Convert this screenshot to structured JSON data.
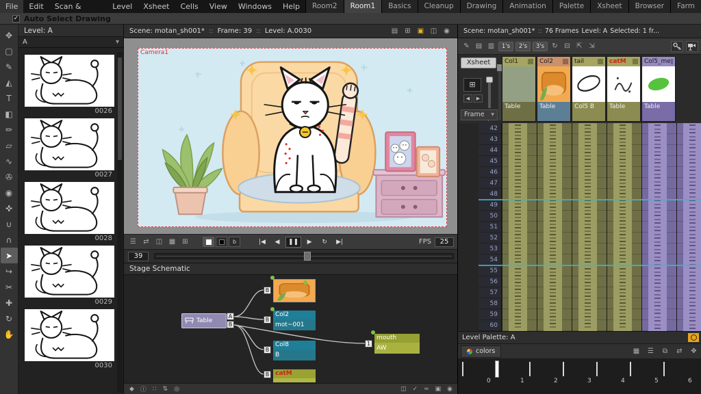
{
  "colors": {
    "olive_header": "#a6a562",
    "olive_cell": "#6e6f45",
    "olive_stripe": "#9c9d63",
    "salmon_header": "#cb916c",
    "purple_header": "#998ac0",
    "purple_cell": "#756aa0",
    "teal_node": "#1f7f98",
    "olive_node": "#96a033",
    "table_node": "#9189b2",
    "marker_cyan": "#3fb6c9",
    "camera_red": "#e03030",
    "catm_red": "#cc2415",
    "power_yellow": "#e6a520"
  },
  "menubar": {
    "items": [
      "File",
      "Edit",
      "Scan & Cleanup",
      "Level",
      "Xsheet",
      "Cells",
      "View",
      "Windows",
      "Help"
    ]
  },
  "rooms": {
    "tabs": [
      "Room2",
      "Room1",
      "Basics",
      "Cleanup",
      "Drawing",
      "Animation",
      "Palette",
      "Xsheet",
      "Browser",
      "Farm"
    ],
    "active": "Room1"
  },
  "options_bar": {
    "auto_select_label": "Auto Select Drawing"
  },
  "tools": {
    "items": [
      {
        "name": "animate-tool",
        "glyph": "✥"
      },
      {
        "name": "selection-tool",
        "glyph": "▢"
      },
      {
        "name": "brush-tool",
        "glyph": "✎"
      },
      {
        "name": "geometric-tool",
        "glyph": "◭"
      },
      {
        "name": "type-tool",
        "glyph": "T"
      },
      {
        "name": "fill-tool",
        "glyph": "◧"
      },
      {
        "name": "paint-brush-tool",
        "glyph": "✏"
      },
      {
        "name": "eraser-tool",
        "glyph": "▱"
      },
      {
        "name": "tape-tool",
        "glyph": "∿"
      },
      {
        "name": "style-picker-tool",
        "glyph": "✇"
      },
      {
        "name": "rgb-picker-tool",
        "glyph": "◉"
      },
      {
        "name": "control-point-tool",
        "glyph": "✜"
      },
      {
        "name": "pinch-tool",
        "glyph": "∪"
      },
      {
        "name": "pump-tool",
        "glyph": "∩"
      },
      {
        "name": "pointer-tool",
        "glyph": "➤"
      },
      {
        "name": "bender-tool",
        "glyph": "↪"
      },
      {
        "name": "cutter-tool",
        "glyph": "✂"
      },
      {
        "name": "hook-tool",
        "glyph": "✚"
      },
      {
        "name": "rotate-tool",
        "glyph": "↻"
      },
      {
        "name": "hand-tool",
        "glyph": "✋"
      }
    ]
  },
  "level_strip": {
    "title": "Level:  A",
    "selector_value": "A",
    "drawings": [
      "0026",
      "0027",
      "0028",
      "0029",
      "0030"
    ]
  },
  "viewer": {
    "scene": "Scene: motan_sh001*",
    "sep": "::",
    "frame": "Frame: 39",
    "level": "Level: A.0030",
    "camera_name": "Camera1",
    "fps_label": "FPS",
    "fps_value": "25",
    "frame_value": "39",
    "view_mode_b": "b",
    "header_icons": [
      {
        "name": "safe-area-icon",
        "glyph": "▤"
      },
      {
        "name": "field-guide-icon",
        "glyph": "⊞"
      },
      {
        "name": "camera-view-icon",
        "glyph": "▣"
      },
      {
        "name": "freeze-icon",
        "glyph": "◫"
      },
      {
        "name": "preview-icon",
        "glyph": "◉"
      }
    ]
  },
  "playback": {
    "left_icons": [
      {
        "name": "console-icon",
        "glyph": "☰"
      },
      {
        "name": "flip-horizontal-icon",
        "glyph": "⇄"
      },
      {
        "name": "compare-icon",
        "glyph": "◫"
      },
      {
        "name": "histogram-icon",
        "glyph": "▦"
      },
      {
        "name": "locator-icon",
        "glyph": "⊞"
      }
    ],
    "transport": [
      {
        "name": "first-frame-button",
        "glyph": "|◀"
      },
      {
        "name": "prev-frame-button",
        "glyph": "◀"
      },
      {
        "name": "pause-button",
        "glyph": "❚❚"
      },
      {
        "name": "play-button",
        "glyph": "▶"
      },
      {
        "name": "loop-button",
        "glyph": "↻"
      },
      {
        "name": "last-frame-button",
        "glyph": "▶|"
      }
    ]
  },
  "schematic": {
    "title": "Stage Schematic",
    "table_label": "Table",
    "port_a": "A",
    "port_b": "B",
    "port_1": "1",
    "nodes": {
      "col2": {
        "label": "Col2",
        "body": "mot~001"
      },
      "col8": {
        "label": "Col8",
        "body": "B"
      },
      "catm": {
        "label": "catM"
      },
      "mouth": {
        "label": "mouth",
        "body": "AW"
      }
    }
  },
  "bottom_toolbar": {
    "left": [
      {
        "name": "set-key-icon",
        "glyph": "◆"
      },
      {
        "name": "info-icon",
        "glyph": "ⓘ"
      },
      {
        "name": "grid-dots-icon",
        "glyph": "∷"
      },
      {
        "name": "swap-icon",
        "glyph": "⇅"
      },
      {
        "name": "target-icon",
        "glyph": "◎"
      }
    ],
    "right": [
      {
        "name": "toggle-panel-icon",
        "glyph": "◫"
      },
      {
        "name": "check-icon",
        "glyph": "✓"
      },
      {
        "name": "onion-skin-icon",
        "glyph": "≈"
      },
      {
        "name": "snap-icon",
        "glyph": "▣"
      },
      {
        "name": "camera-toggle-icon",
        "glyph": "◉"
      }
    ]
  },
  "xsheet": {
    "scene": "Scene: motan_sh001*",
    "sep": "::",
    "frames": "76 Frames",
    "level": "Level: A",
    "selected": "Selected: 1 fr...",
    "toolbar": {
      "icons_left": [
        {
          "name": "new-vector-level-icon",
          "glyph": "✎"
        },
        {
          "name": "new-toonz-raster-level-icon",
          "glyph": "▤"
        },
        {
          "name": "new-raster-level-icon",
          "glyph": "▥"
        }
      ],
      "steps": [
        "1's",
        "2's",
        "3's"
      ],
      "icons_mid": [
        {
          "name": "repeat-icon",
          "glyph": "↻"
        },
        {
          "name": "collapse-icon",
          "glyph": "⊟"
        },
        {
          "name": "open-subxsheet-icon",
          "glyph": "⇱"
        },
        {
          "name": "close-subxsheet-icon",
          "glyph": "⇲"
        }
      ]
    },
    "xsheet_button": "Xsheet",
    "frame_selector": "Frame",
    "columns": [
      {
        "name": "Col1",
        "parent": "Table",
        "header_hex": "#a6a562",
        "cell_hex": "#6e6f45"
      },
      {
        "name": "Col2",
        "parent": "Table",
        "header_hex": "#cb916c",
        "cell_hex": "#6e6f45"
      },
      {
        "name": "tail",
        "parent": "Col5  B",
        "header_hex": "#a6a562",
        "cell_hex": "#6e6f45"
      },
      {
        "name": "catM",
        "parent": "Table",
        "header_hex": "#a6a562",
        "cell_hex": "#6e6f45",
        "name_hex": "#cc2415"
      },
      {
        "name": "Col5_me",
        "parent": "Table",
        "header_hex": "#998ac0",
        "cell_hex": "#756aa0"
      }
    ],
    "rows": [
      "42",
      "43",
      "44",
      "45",
      "46",
      "47",
      "48",
      "49",
      "50",
      "51",
      "52",
      "53",
      "54",
      "55",
      "56",
      "57",
      "58",
      "59",
      "60"
    ]
  },
  "palette": {
    "title": "Level Palette: A",
    "tab": "colors",
    "toolbar_icons": [
      {
        "name": "grid-view-icon",
        "glyph": "▦"
      },
      {
        "name": "list-view-icon",
        "glyph": "☰"
      },
      {
        "name": "copy-page-icon",
        "glyph": "⧉"
      },
      {
        "name": "swap-colors-icon",
        "glyph": "⇄"
      },
      {
        "name": "palette-options-icon",
        "glyph": "✥"
      }
    ],
    "swatches": [
      {
        "n": "0",
        "type": "split"
      },
      {
        "n": "1",
        "hex": "#000000",
        "selected": true
      },
      {
        "n": "2",
        "hex": "#ffffff"
      },
      {
        "n": "3",
        "hex": "#e8400e"
      },
      {
        "n": "4",
        "hex": "#ffffff"
      },
      {
        "n": "5",
        "hex": "#000000"
      },
      {
        "n": "6",
        "hex": "#f2c9a8"
      }
    ]
  }
}
